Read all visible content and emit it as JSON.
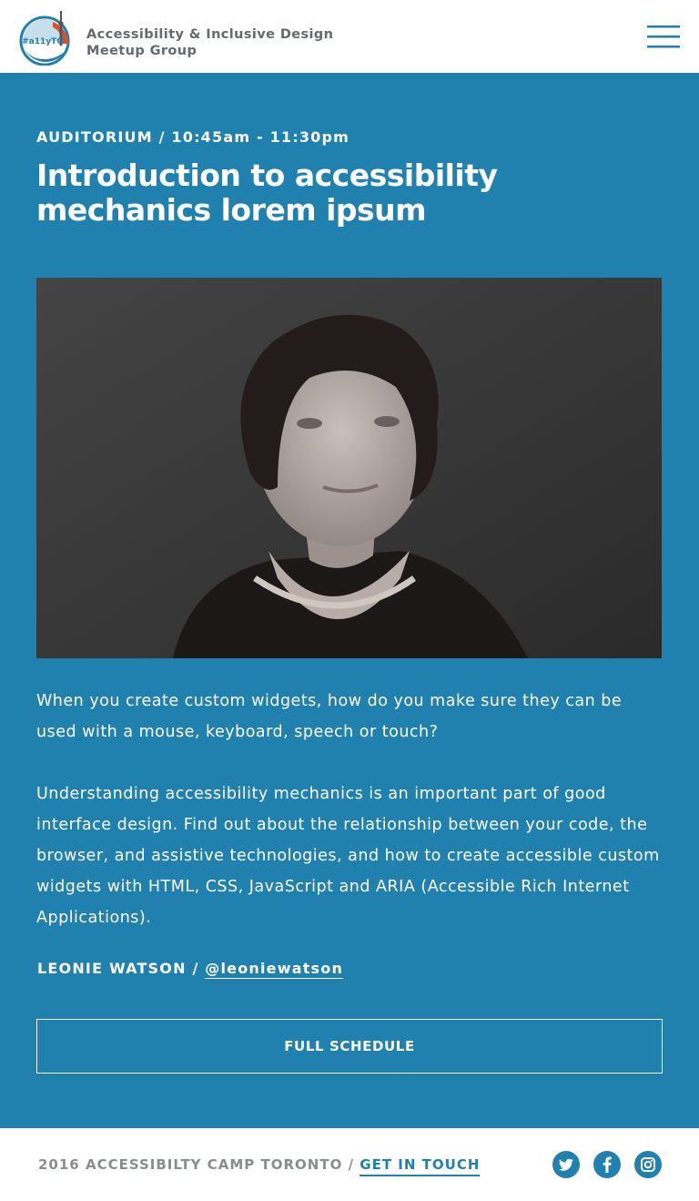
{
  "header": {
    "logo_text": "#a11yTO",
    "site_name_line1": "Accessibility & Inclusive Design",
    "site_name_line2": "Meetup Group",
    "menu_icon": "hamburger-menu-icon"
  },
  "session": {
    "meta": "AUDITORIUM / 10:45am - 11:30pm",
    "title": "Introduction to accessibility mechanics lorem ipsum",
    "description_1": "When you create custom widgets, how do you make sure they can be used with a mouse, keyboard, speech or touch?",
    "description_2": "Understanding accessibility mechanics is an important part of good interface design. Find out about the relationship between your code, the browser, and assistive technologies, and how to create accessible custom widgets with HTML, CSS, JavaScript and ARIA (Accessible Rich Internet Applications).",
    "speaker_name": "LEONIE WATSON",
    "speaker_separator": " / ",
    "speaker_handle": "@leoniewatson",
    "schedule_button": "FULL SCHEDULE"
  },
  "footer": {
    "text": "2016 ACCESSIBILTY CAMP TORONTO / ",
    "contact_link": "GET IN TOUCH",
    "social": [
      "twitter-icon",
      "facebook-icon",
      "instagram-icon"
    ]
  },
  "colors": {
    "primary_blue": "#2080ae",
    "header_text": "#666a6e",
    "footer_text": "#8a8d90",
    "logo_orange": "#e0502a"
  }
}
